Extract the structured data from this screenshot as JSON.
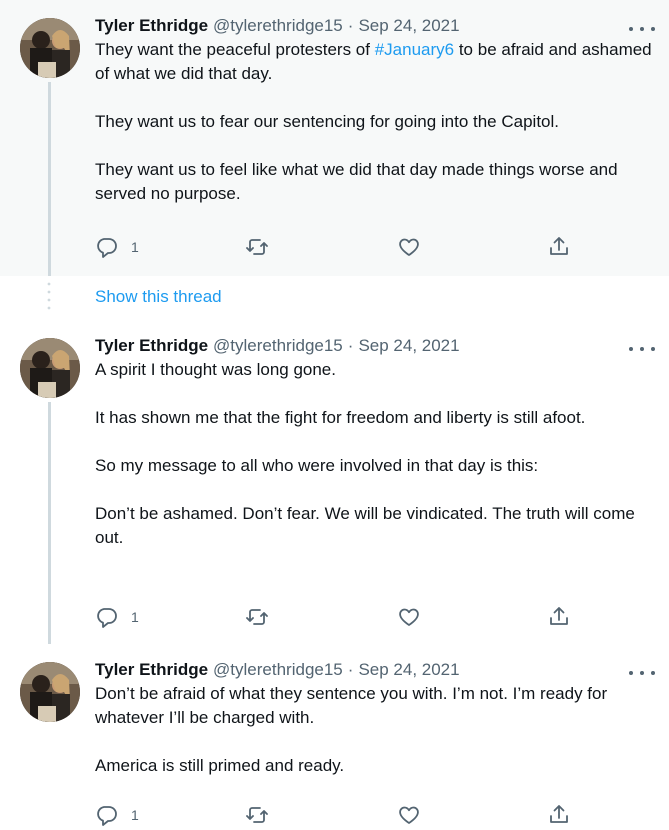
{
  "colors": {
    "link": "#1d9bf0",
    "muted": "#536471",
    "highlight_bg": "#f7f9f9",
    "thread_line": "#cfd9de"
  },
  "icons": {
    "reply": "reply-icon",
    "retweet": "retweet-icon",
    "like": "heart-icon",
    "share": "share-icon",
    "more": "more-icon"
  },
  "show_thread_label": "Show this thread",
  "tweets": [
    {
      "author": "Tyler Ethridge",
      "handle": "@tylerethridge15",
      "separator": "·",
      "date": "Sep 24, 2021",
      "text_before_hashtag": "They want the peaceful protesters of ",
      "hashtag": "#January6",
      "text_after_hashtag": " to be afraid and ashamed of what we did that day.",
      "paragraphs": [
        "They want us to fear our sentencing for going into the Capitol.",
        "They want us to feel like what we did that day made things worse and served no purpose."
      ],
      "reply_count": "1"
    },
    {
      "author": "Tyler Ethridge",
      "handle": "@tylerethridge15",
      "separator": "·",
      "date": "Sep 24, 2021",
      "paragraphs": [
        "A spirit I thought was long gone.",
        "It has shown me that the fight for freedom and liberty is still afoot.",
        "So my message to all who were involved in that day is this:",
        "Don’t be ashamed. Don’t fear. We will be vindicated. The truth will come out."
      ],
      "reply_count": "1"
    },
    {
      "author": "Tyler Ethridge",
      "handle": "@tylerethridge15",
      "separator": "·",
      "date": "Sep 24, 2021",
      "paragraphs": [
        "Don’t be afraid of what they sentence you with. I’m not. I’m ready for whatever I’ll be charged with.",
        "America is still primed and ready."
      ],
      "reply_count": "1"
    }
  ]
}
